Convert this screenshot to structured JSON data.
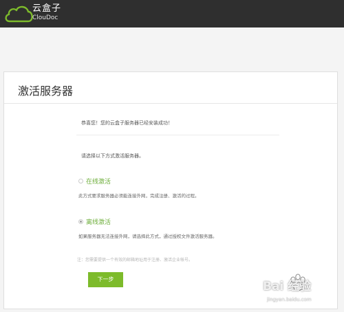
{
  "header": {
    "logo_cn": "云盒子",
    "logo_en": "ClouDoc"
  },
  "card": {
    "title": "激活服务器",
    "success_msg": "恭喜您！您的云盒子服务器已经安装成功！",
    "choose_msg": "请选择以下方式激活服务器。",
    "online": {
      "label": "在线激活",
      "desc": "此方式要求服务器必须能连接外网，完成注册、激活的过程。",
      "checked": false
    },
    "offline": {
      "label": "离线激活",
      "desc": "如果服务器无法连接外网，请选择此方式，通过授权文件激活服务器。",
      "checked": true
    },
    "note": "注：您需要提供一个有效的邮箱地址用于注册、激活企业帐号。",
    "next_label": "下一步"
  },
  "watermark": {
    "text": "Bai 经验",
    "url": "jingyan.baidu.com"
  },
  "colors": {
    "topbar": "#2f2f2f",
    "accent": "#7dbb2b",
    "option_label": "#6dae3a"
  }
}
